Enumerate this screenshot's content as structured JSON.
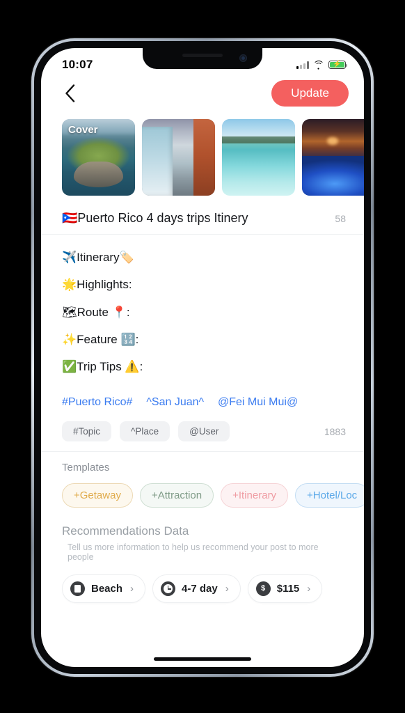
{
  "status_bar": {
    "time": "10:07",
    "signal_icon": "cellular-signal-icon",
    "wifi_icon": "wifi-icon",
    "battery_icon": "battery-charging-icon"
  },
  "nav": {
    "back_icon": "chevron-left-icon",
    "update_label": "Update"
  },
  "photos": [
    {
      "name": "photo-el-morro-aerial",
      "badge": "Cover"
    },
    {
      "name": "photo-old-san-juan-street",
      "badge": ""
    },
    {
      "name": "photo-turquoise-bay-boats",
      "badge": ""
    },
    {
      "name": "photo-bioluminescent-bay",
      "badge": ""
    }
  ],
  "post": {
    "title": "🇵🇷Puerto Rico 4 days trips Itinery",
    "title_count": "58",
    "body_lines": [
      "✈️Itinerary🏷️",
      "🌟Highlights:",
      "🗺Route 📍:",
      "✨Feature 🔢:",
      "✅Trip Tips ⚠️:"
    ],
    "links": [
      "#Puerto Rico#",
      "^San Juan^",
      "@Fei Mui Mui@"
    ],
    "insert_chips": [
      "#Topic",
      "^Place",
      "@User"
    ],
    "body_count": "1883"
  },
  "templates": {
    "heading": "Templates",
    "items": [
      {
        "label": "+Getaway",
        "color": "#e0ab4b"
      },
      {
        "label": "+Attraction",
        "color": "#7f9b87"
      },
      {
        "label": "+Itinerary",
        "color": "#ef9ba2"
      },
      {
        "label": "+Hotel/Loc",
        "color": "#5aa8e8"
      }
    ]
  },
  "recommendations": {
    "heading": "Recommendations Data",
    "subtitle": "Tell us more information to help us recommend your post to more people",
    "items": [
      {
        "icon": "island-icon",
        "label": "Beach",
        "chevron": "›"
      },
      {
        "icon": "clock-icon",
        "label": "4-7 day",
        "chevron": "›"
      },
      {
        "icon": "dollar-icon",
        "label": "$115",
        "chevron": "›"
      }
    ]
  },
  "colors": {
    "accent": "#f4605f",
    "link": "#3b7cf0",
    "muted": "#a8acb2"
  }
}
